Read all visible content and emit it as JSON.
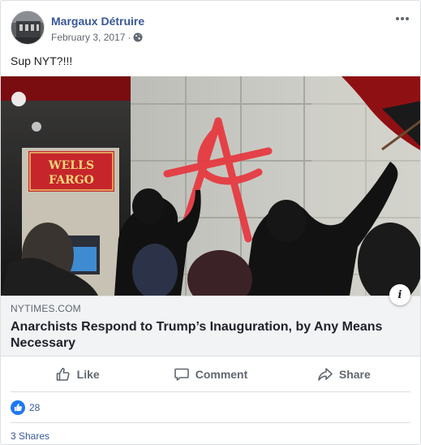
{
  "post": {
    "author": "Margaux Détruire",
    "date": "February 3, 2017",
    "separator": "·",
    "text": "Sup NYT?!!!",
    "privacy_icon": "globe-icon",
    "more_icon": "more-options-icon"
  },
  "link": {
    "domain": "NYTIMES.COM",
    "title": "Anarchists Respond to Trump’s Inauguration, by Any Means Necessary",
    "image_sign_text": [
      "WELLS",
      "FARGO"
    ],
    "info_icon_label": "i"
  },
  "actions": [
    {
      "label": "Like",
      "icon": "thumbs-up-icon"
    },
    {
      "label": "Comment",
      "icon": "comment-icon"
    },
    {
      "label": "Share",
      "icon": "share-icon"
    }
  ],
  "reactions": {
    "count": "28",
    "icon": "like-reaction-icon"
  },
  "shares": "3 Shares",
  "colors": {
    "link_blue": "#385898",
    "meta_gray": "#606770",
    "link_panel_bg": "#f2f3f5",
    "like_blue": "#2078f4",
    "graffiti_red": "#e8333b"
  }
}
